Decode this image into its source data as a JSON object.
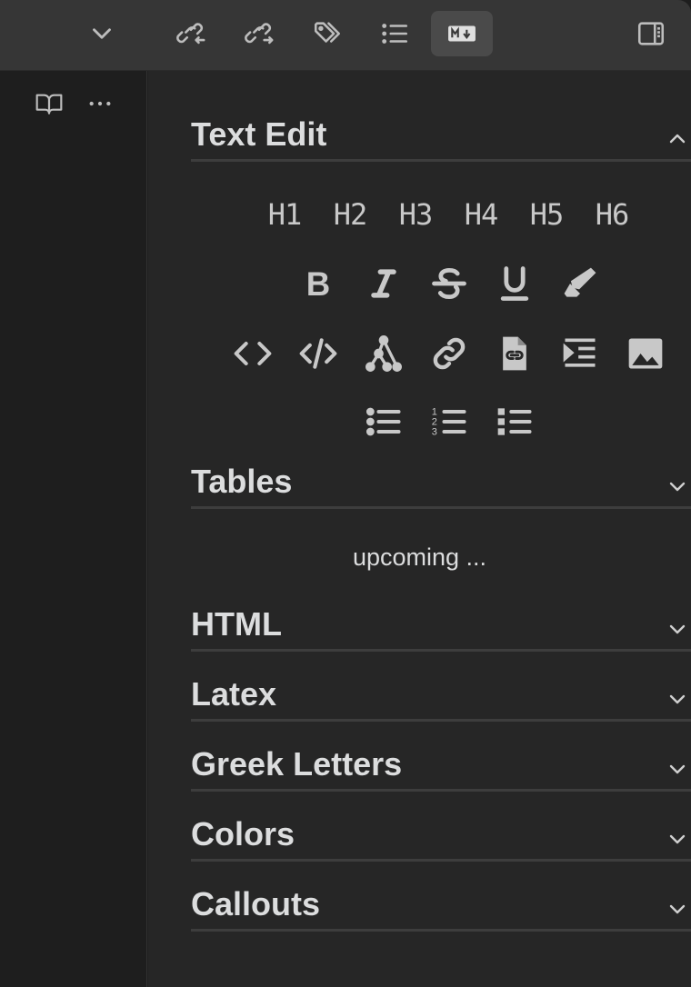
{
  "sections": {
    "text_edit": "Text Edit",
    "tables": "Tables",
    "tables_placeholder": "upcoming ...",
    "html": "HTML",
    "latex": "Latex",
    "greek": "Greek Letters",
    "colors": "Colors",
    "callouts": "Callouts"
  },
  "headings": [
    "H1",
    "H2",
    "H3",
    "H4",
    "H5",
    "H6"
  ],
  "toolbar_icons": [
    "chevron-down-icon",
    "backlinks-icon",
    "outgoing-links-icon",
    "tags-icon",
    "outline-icon",
    "markdown-icon",
    "sidebar-toggle-icon"
  ],
  "colors": {
    "panel": "#262626",
    "topbar": "#363636",
    "icon": "#c8c8c8"
  }
}
